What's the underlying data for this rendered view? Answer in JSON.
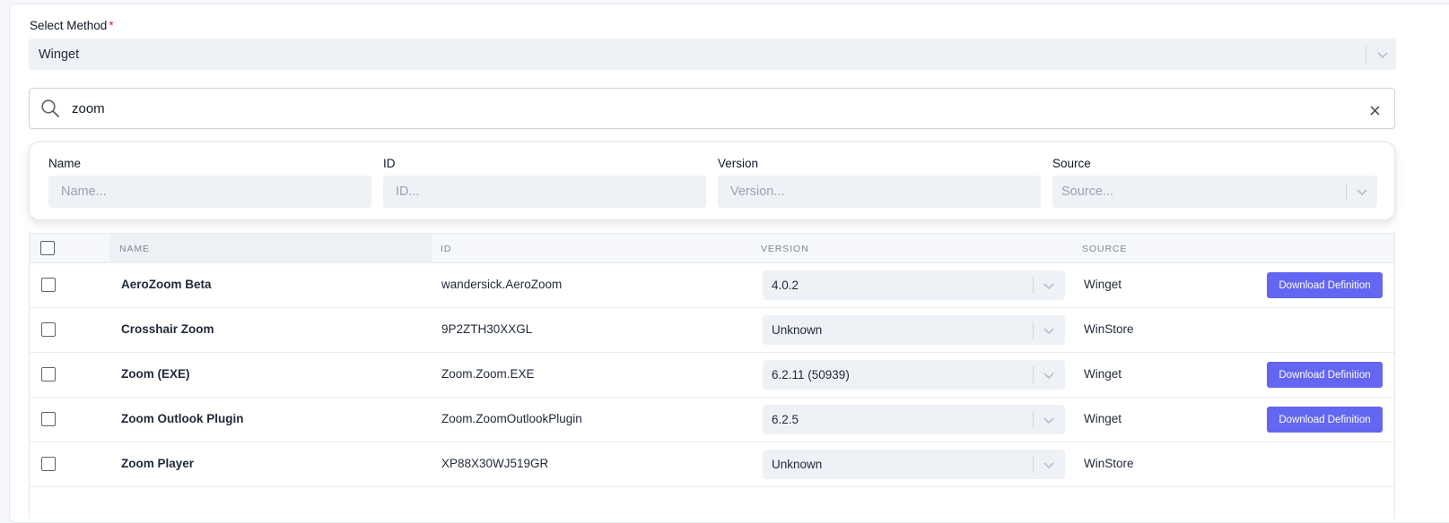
{
  "method": {
    "label": "Select Method",
    "required_mark": "*",
    "value": "Winget"
  },
  "search": {
    "value": "zoom",
    "icon": "search-icon",
    "clear_icon": "close-icon"
  },
  "filters": {
    "name": {
      "label": "Name",
      "placeholder": "Name..."
    },
    "id": {
      "label": "ID",
      "placeholder": "ID..."
    },
    "version": {
      "label": "Version",
      "placeholder": "Version..."
    },
    "source": {
      "label": "Source",
      "placeholder": "Source..."
    }
  },
  "table": {
    "headers": {
      "name": "NAME",
      "id": "ID",
      "version": "VERSION",
      "source": "SOURCE"
    },
    "rows": [
      {
        "name": "AeroZoom Beta",
        "id": "wandersick.AeroZoom",
        "version": "4.0.2",
        "source": "Winget",
        "action": "Download Definition"
      },
      {
        "name": "Crosshair Zoom",
        "id": "9P2ZTH30XXGL",
        "version": "Unknown",
        "source": "WinStore",
        "action": ""
      },
      {
        "name": "Zoom (EXE)",
        "id": "Zoom.Zoom.EXE",
        "version": "6.2.11 (50939)",
        "source": "Winget",
        "action": "Download Definition"
      },
      {
        "name": "Zoom Outlook Plugin",
        "id": "Zoom.ZoomOutlookPlugin",
        "version": "6.2.5",
        "source": "Winget",
        "action": "Download Definition"
      },
      {
        "name": "Zoom Player",
        "id": "XP88X30WJ519GR",
        "version": "Unknown",
        "source": "WinStore",
        "action": ""
      }
    ]
  },
  "colors": {
    "accent": "#6366f1",
    "required": "#e11d48",
    "input_bg": "#eef2f6"
  }
}
